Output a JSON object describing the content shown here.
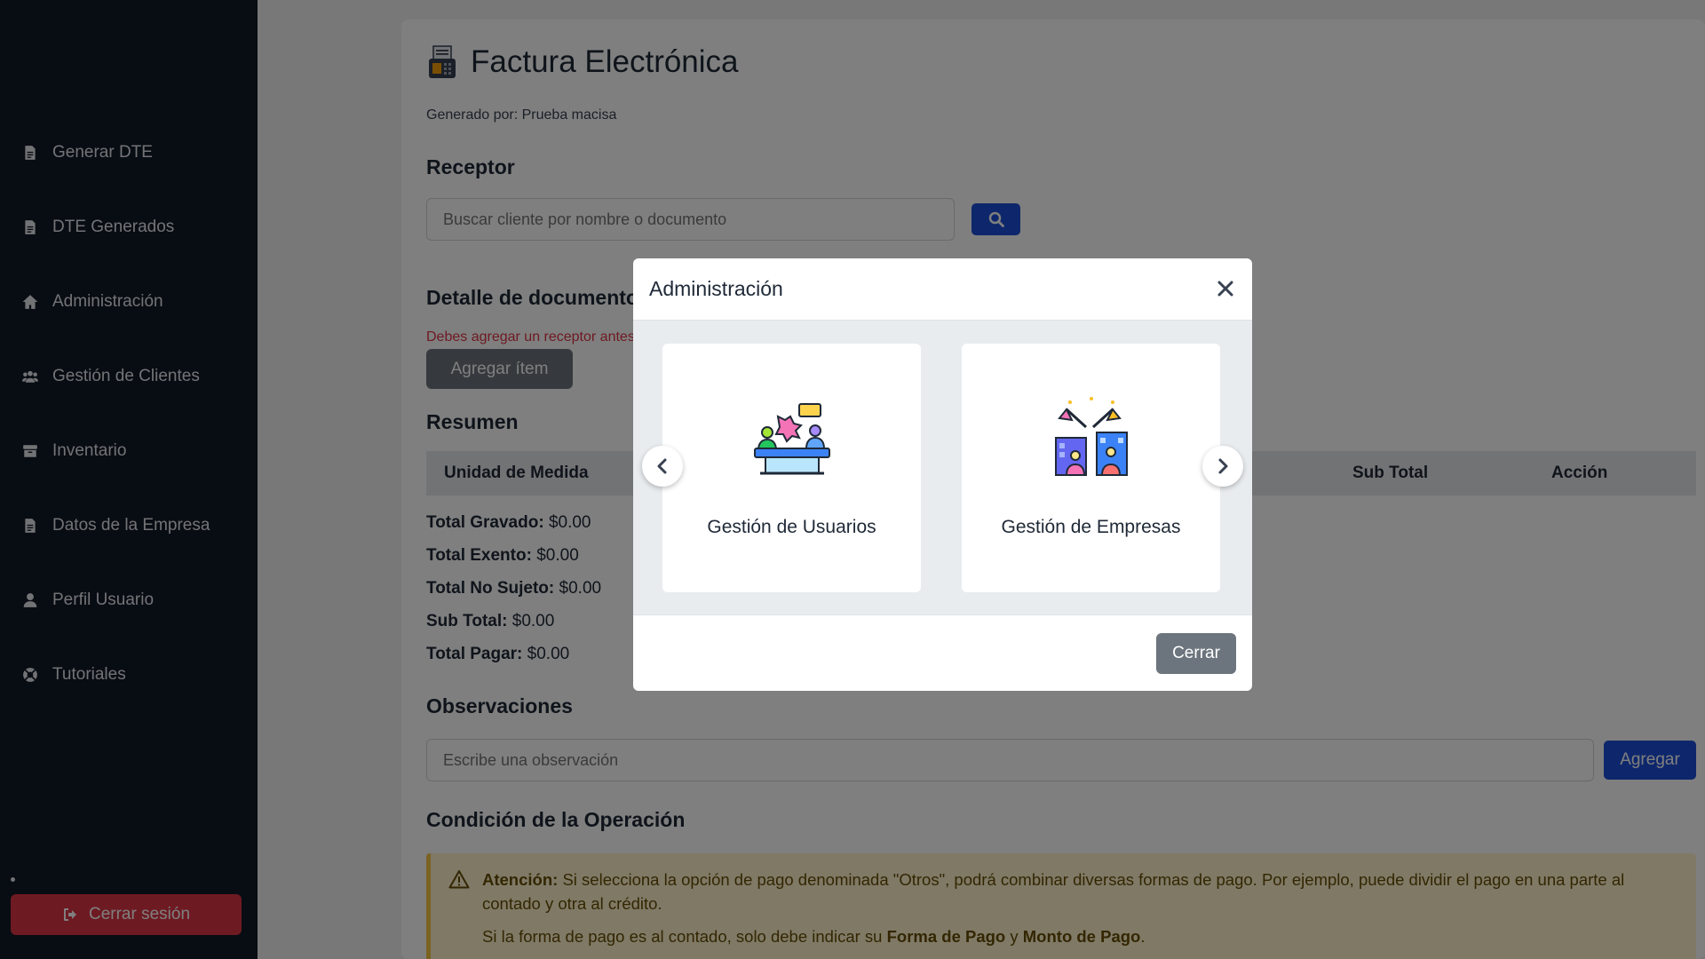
{
  "sidebar": {
    "items": [
      {
        "label": "Generar DTE",
        "icon": "document-icon"
      },
      {
        "label": "DTE Generados",
        "icon": "document-icon"
      },
      {
        "label": "Administración",
        "icon": "home-icon"
      },
      {
        "label": "Gestión de Clientes",
        "icon": "users-icon"
      },
      {
        "label": "Inventario",
        "icon": "box-icon"
      },
      {
        "label": "Datos de la Empresa",
        "icon": "document-icon"
      },
      {
        "label": "Perfil Usuario",
        "icon": "user-icon"
      },
      {
        "label": "Tutoriales",
        "icon": "lifebuoy-icon"
      }
    ],
    "logout_label": "Cerrar sesión"
  },
  "page": {
    "title": "Factura Electrónica",
    "generated_by": "Generado por: Prueba macisa",
    "receptor_heading": "Receptor",
    "search_placeholder": "Buscar cliente por nombre o documento",
    "detail_heading": "Detalle de documento",
    "receptor_warning": "Debes agregar un receptor antes",
    "add_item_label": "Agregar ítem",
    "summary_heading": "Resumen",
    "table_headers": {
      "unit": "Unidad de Medida",
      "subtotal": "Sub Total",
      "action": "Acción"
    },
    "totals": [
      {
        "label": "Total Gravado:",
        "value": "$0.00"
      },
      {
        "label": "Total Exento:",
        "value": "$0.00"
      },
      {
        "label": "Total No Sujeto:",
        "value": "$0.00"
      },
      {
        "label": "Sub Total:",
        "value": "$0.00"
      },
      {
        "label": "Total Pagar:",
        "value": "$0.00"
      }
    ],
    "observations_heading": "Observaciones",
    "observation_placeholder": "Escribe una observación",
    "add_observation_label": "Agregar",
    "condition_heading": "Condición de la Operación",
    "alert": {
      "bold": "Atención:",
      "text1": " Si selecciona la opción de pago denominada \"Otros\", podrá combinar diversas formas de pago. Por ejemplo, puede dividir el pago en una parte al contado y otra al crédito.",
      "text2_prefix": "Si la forma de pago es al contado, solo debe indicar su ",
      "text2_b1": "Forma de Pago",
      "text2_mid": " y ",
      "text2_b2": "Monto de Pago",
      "text2_suffix": "."
    }
  },
  "modal": {
    "title": "Administración",
    "cards": [
      {
        "label": "Gestión de Usuarios",
        "icon": "team-meeting-illustration"
      },
      {
        "label": "Gestión de Empresas",
        "icon": "companies-illustration"
      }
    ],
    "close_label": "Cerrar"
  },
  "colors": {
    "sidebar_bg": "#111827",
    "primary": "#1d4ed8",
    "danger": "#dc3545",
    "secondary": "#6c757d",
    "warning_bg": "#fff3cd"
  }
}
